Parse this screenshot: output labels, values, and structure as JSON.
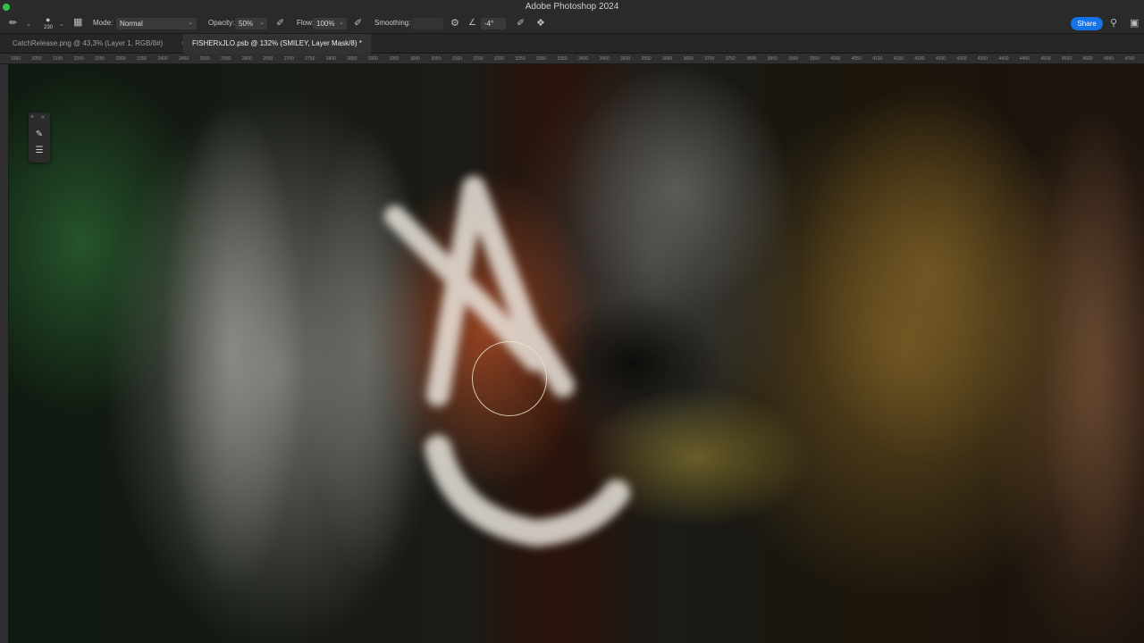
{
  "window": {
    "title": "Adobe Photoshop 2024"
  },
  "options_bar": {
    "brush_size": "230",
    "mode_label": "Mode:",
    "mode_value": "Normal",
    "opacity_label": "Opacity:",
    "opacity_value": "50%",
    "flow_label": "Flow:",
    "flow_value": "100%",
    "smoothing_label": "Smoothing:",
    "angle_value": "-4°",
    "share_label": "Share"
  },
  "tabs": [
    {
      "label": "CatchRelease.png @ 43,3% (Layer 1, RGB/8#)",
      "active": false
    },
    {
      "label": "FISHERxJLO.psb @ 132% (SMILEY, Layer Mask/8) *",
      "active": true
    }
  ],
  "ruler": {
    "ticks": [
      "1950",
      "2050",
      "2150",
      "2200",
      "2250",
      "2300",
      "2350",
      "2400",
      "2450",
      "2500",
      "2550",
      "2600",
      "2650",
      "2700",
      "2750",
      "2800",
      "2850",
      "2900",
      "2950",
      "3000",
      "3050",
      "3100",
      "3150",
      "3200",
      "3250",
      "3300",
      "3350",
      "3400",
      "3450",
      "3500",
      "3550",
      "3600",
      "3650",
      "3700",
      "3750",
      "3800",
      "3850",
      "3900",
      "3950",
      "4000",
      "4050",
      "4100",
      "4150",
      "4200",
      "4250",
      "4300",
      "4350",
      "4400",
      "4450",
      "4500",
      "4550",
      "4600",
      "4650",
      "4700"
    ]
  },
  "colors": {
    "accent": "#1473e6",
    "brush_stroke": "#f0ece4"
  }
}
